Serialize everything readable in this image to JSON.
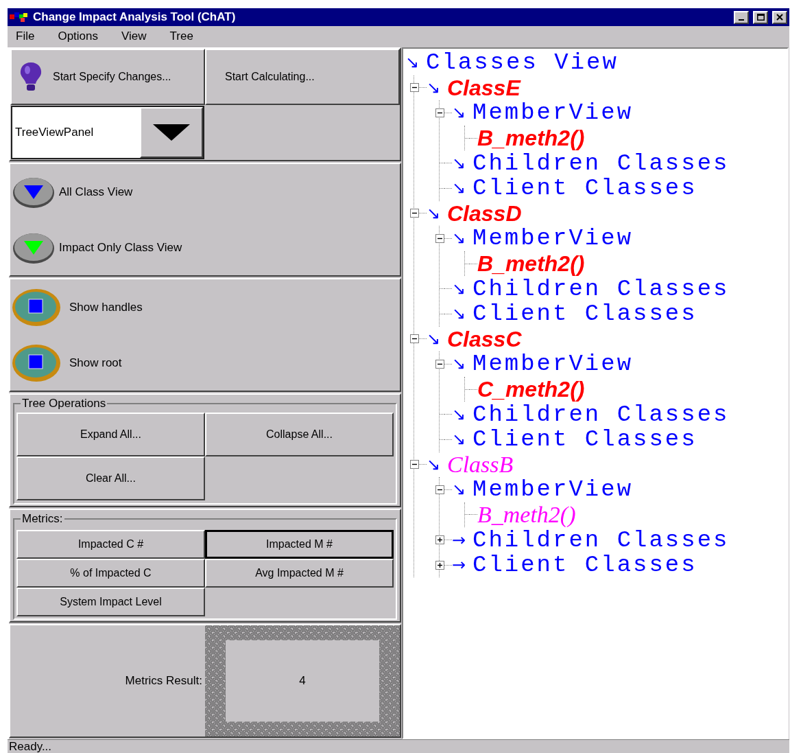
{
  "window": {
    "title": "Change Impact Analysis Tool (ChAT)"
  },
  "menu": [
    "File",
    "Options",
    "View",
    "Tree"
  ],
  "actions": [
    "Start Specify Changes...",
    "Start Calculating..."
  ],
  "panel_select": {
    "value": "TreeViewPanel"
  },
  "view_buttons": [
    {
      "label": "All Class View",
      "color": "#0000ff"
    },
    {
      "label": "Impact Only Class View",
      "color": "#00ff00"
    }
  ],
  "toggle_buttons": [
    "Show handles",
    "Show root"
  ],
  "tree_operations": {
    "title": "Tree Operations",
    "buttons": [
      "Expand All...",
      "Collapse All...",
      "Clear All..."
    ]
  },
  "metrics": {
    "title": "Metrics:",
    "buttons": [
      {
        "label": "Impacted C #",
        "selected": false
      },
      {
        "label": "Impacted M #",
        "selected": true
      },
      {
        "label": "% of Impacted C",
        "selected": false
      },
      {
        "label": "Avg Impacted M #",
        "selected": false
      },
      {
        "label": "System Impact Level",
        "selected": false
      }
    ]
  },
  "metrics_result": {
    "label": "Metrics Result:",
    "value": "4"
  },
  "tree": {
    "label": "Classes View",
    "arrow": "↘",
    "kind": "folder",
    "children": [
      {
        "label": "ClassE",
        "arrow": "↘",
        "kind": "item",
        "strong": true,
        "color": "#ff0000",
        "expanded": true,
        "children": [
          {
            "label": "MemberView",
            "arrow": "↘",
            "kind": "folder",
            "expanded": true,
            "children": [
              {
                "label": "B_meth2()",
                "kind": "item",
                "strong": true,
                "color": "#ff0000"
              }
            ]
          },
          {
            "label": "Children Classes",
            "arrow": "↘",
            "kind": "folder"
          },
          {
            "label": "Client Classes",
            "arrow": "↘",
            "kind": "folder"
          }
        ]
      },
      {
        "label": "ClassD",
        "arrow": "↘",
        "kind": "item",
        "strong": true,
        "color": "#ff0000",
        "expanded": true,
        "children": [
          {
            "label": "MemberView",
            "arrow": "↘",
            "kind": "folder",
            "expanded": true,
            "children": [
              {
                "label": "B_meth2()",
                "kind": "item",
                "strong": true,
                "color": "#ff0000"
              }
            ]
          },
          {
            "label": "Children Classes",
            "arrow": "↘",
            "kind": "folder"
          },
          {
            "label": "Client Classes",
            "arrow": "↘",
            "kind": "folder"
          }
        ]
      },
      {
        "label": "ClassC",
        "arrow": "↘",
        "kind": "item",
        "strong": true,
        "color": "#ff0000",
        "expanded": true,
        "children": [
          {
            "label": "MemberView",
            "arrow": "↘",
            "kind": "folder",
            "expanded": true,
            "children": [
              {
                "label": "C_meth2()",
                "kind": "item",
                "strong": true,
                "color": "#ff0000"
              }
            ]
          },
          {
            "label": "Children Classes",
            "arrow": "↘",
            "kind": "folder"
          },
          {
            "label": "Client Classes",
            "arrow": "↘",
            "kind": "folder"
          }
        ]
      },
      {
        "label": "ClassB",
        "arrow": "↘",
        "kind": "item",
        "strong": false,
        "color": "#ff00ff",
        "expanded": true,
        "children": [
          {
            "label": "MemberView",
            "arrow": "↘",
            "kind": "folder",
            "expanded": true,
            "children": [
              {
                "label": "B_meth2()",
                "kind": "item",
                "strong": false,
                "color": "#ff00ff"
              }
            ]
          },
          {
            "label": "Children Classes",
            "arrow": "→",
            "kind": "folder",
            "expanded": false
          },
          {
            "label": "Client Classes",
            "arrow": "→",
            "kind": "folder",
            "expanded": false
          }
        ]
      }
    ]
  },
  "status_bar": "Ready..."
}
